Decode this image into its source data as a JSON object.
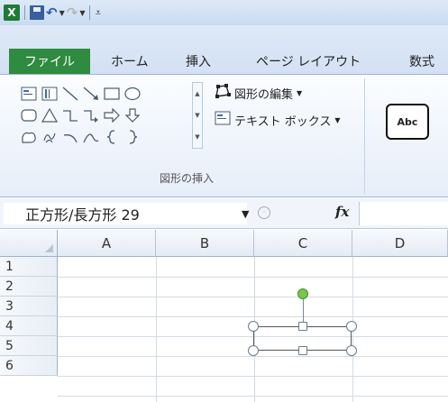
{
  "qat": {
    "app_icon": "X",
    "save_icon": "save-icon",
    "undo_icon": "undo-icon",
    "redo_icon": "redo-icon",
    "customize_icon": "customize-icon"
  },
  "tabs": {
    "file": "ファイル",
    "home": "ホーム",
    "insert": "挿入",
    "page_layout": "ページ レイアウト",
    "formulas": "数式"
  },
  "ribbon": {
    "edit_shape": "図形の編集",
    "text_box": "テキスト ボックス",
    "group_label": "図形の挿入",
    "style_sample": "Abc"
  },
  "formula_bar": {
    "name_box": "正方形/長方形 29",
    "fx": "fx"
  },
  "sheet": {
    "columns": [
      "A",
      "B",
      "C",
      "D"
    ],
    "rows": [
      "1",
      "2",
      "3",
      "4",
      "5",
      "6"
    ]
  },
  "colors": {
    "file_tab": "#2e8b3f",
    "rotation_handle": "#77c84a"
  }
}
